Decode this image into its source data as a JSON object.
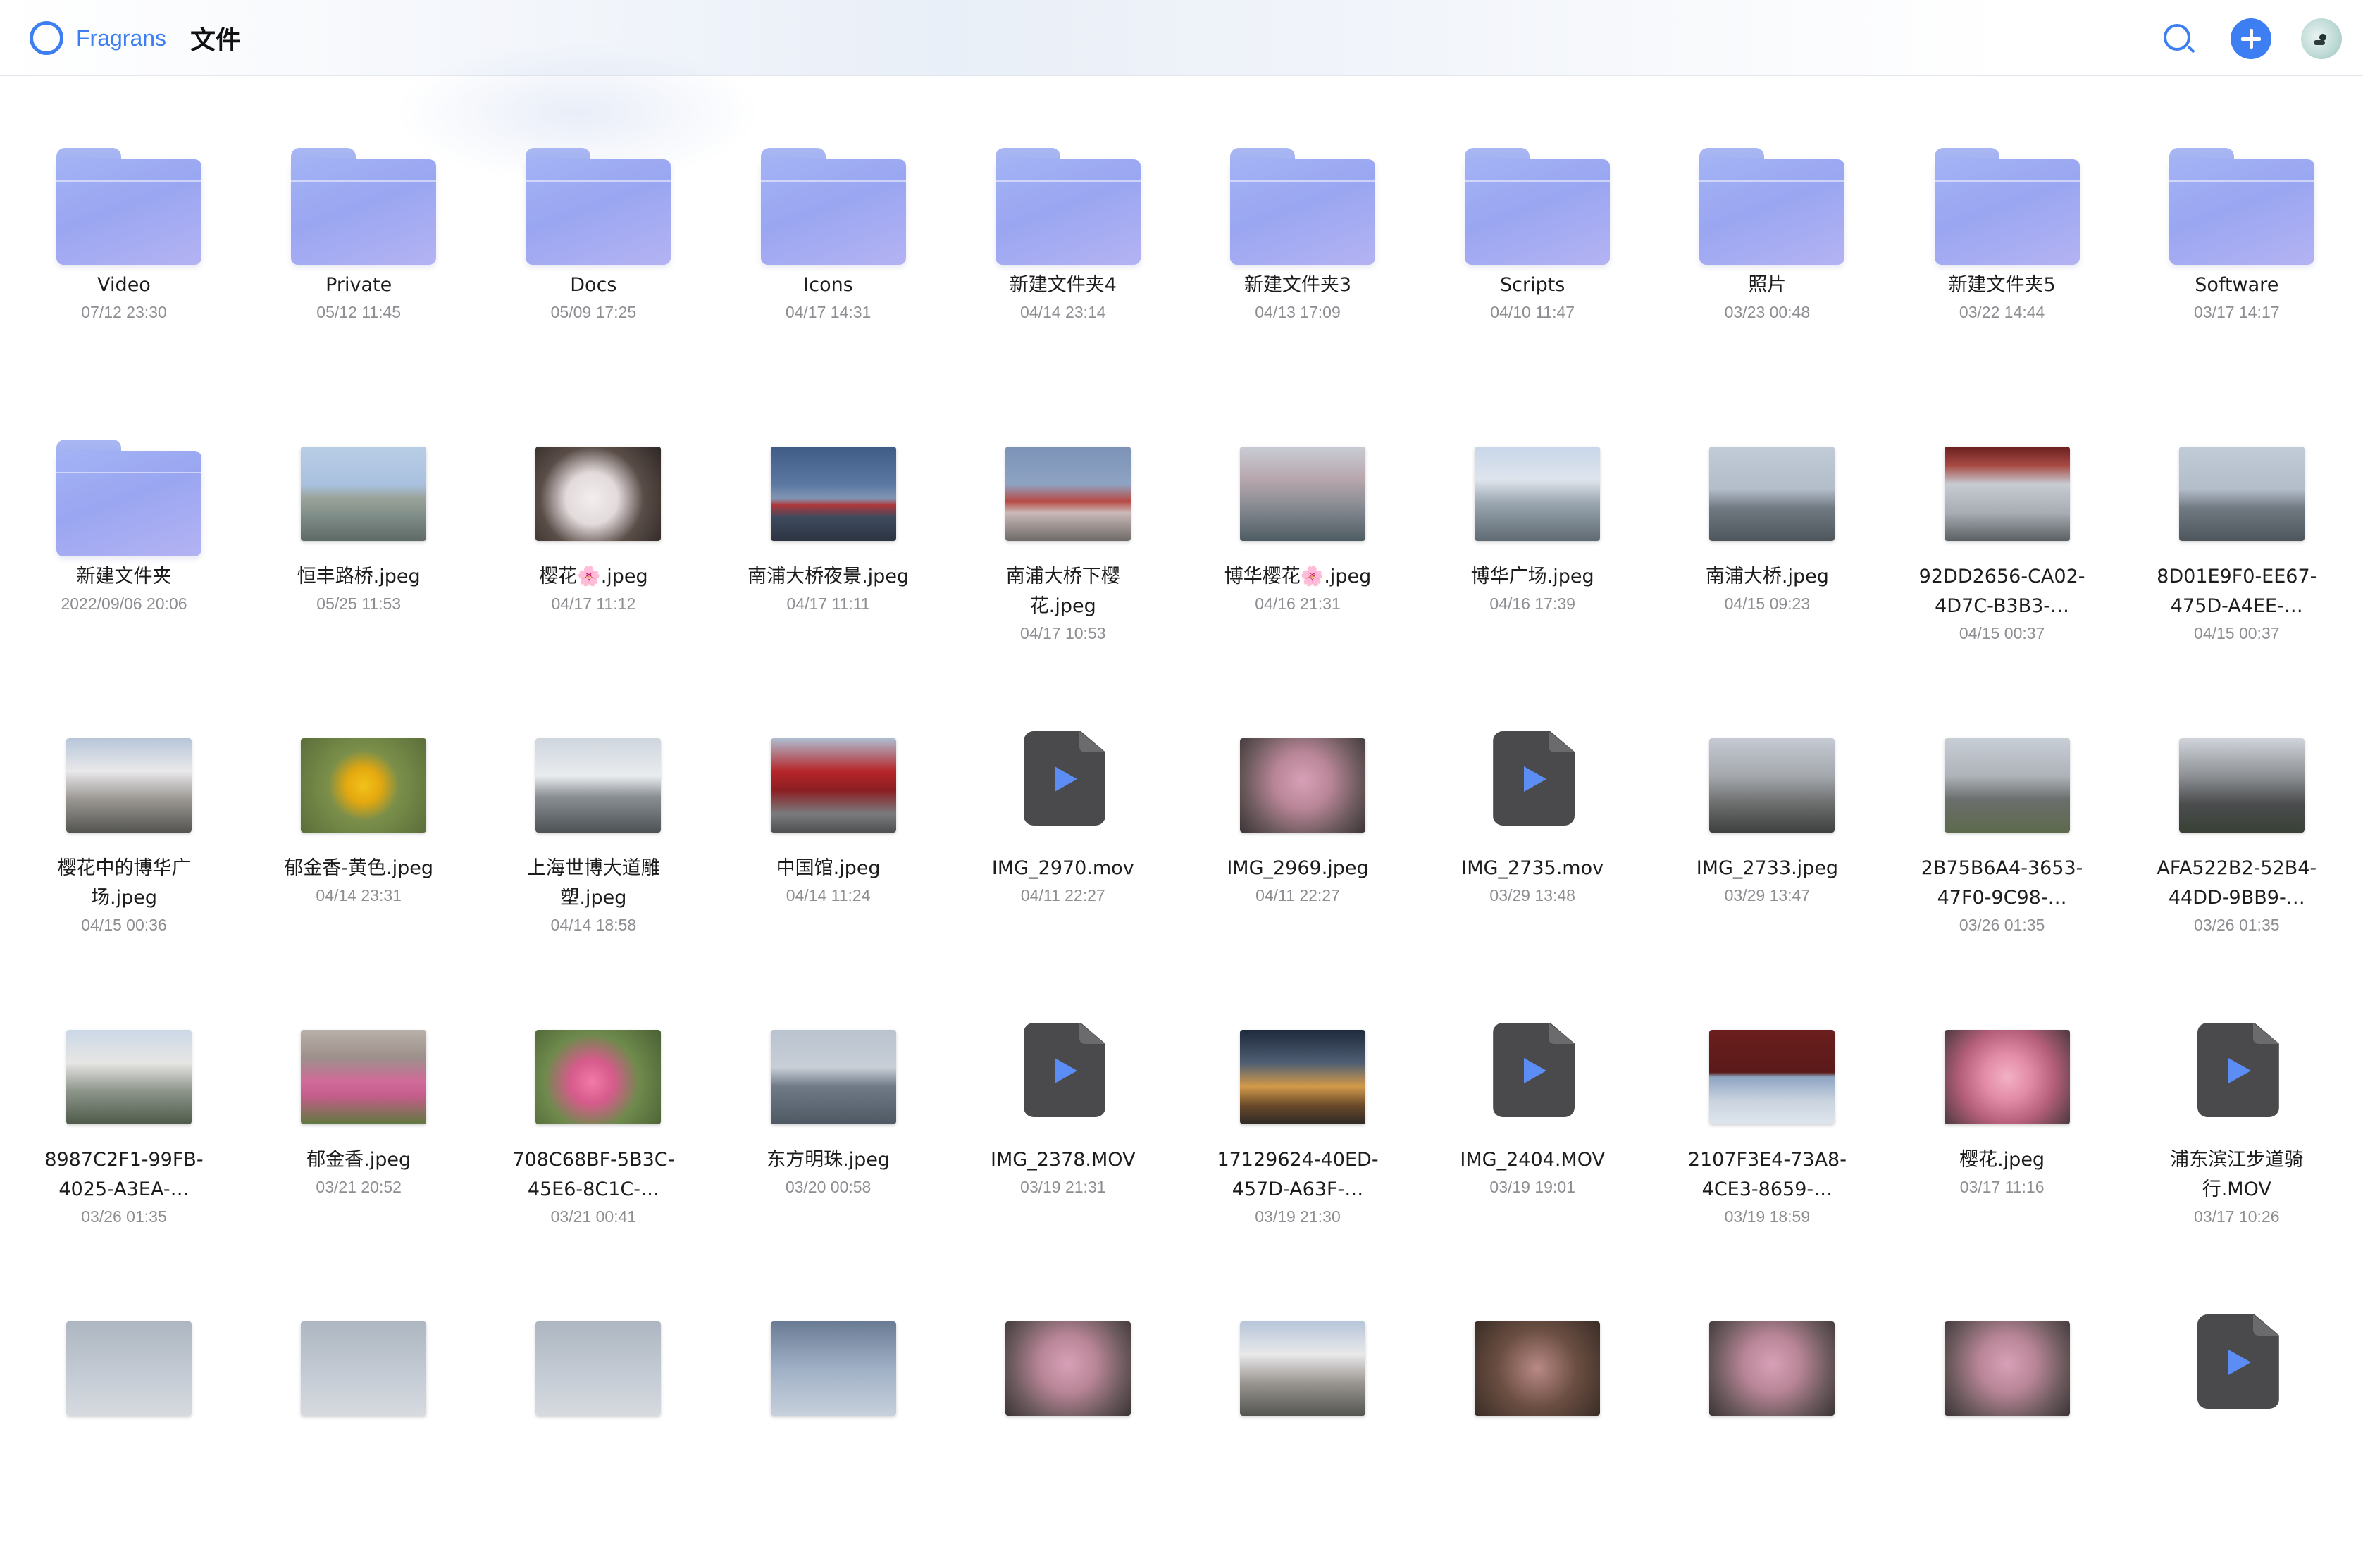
{
  "app": {
    "brand": "Fragrans",
    "title": "文件"
  },
  "colors": {
    "accent": "#3d7ff2",
    "folder": "#a3b3f5",
    "video_icon": "#4a4a4c"
  },
  "toolbar": {
    "search_icon": "search-icon",
    "add_icon": "plus-icon",
    "avatar_icon": "avatar"
  },
  "rows": [
    [
      {
        "kind": "folder",
        "name": "Video",
        "date": "07/12 23:30"
      },
      {
        "kind": "folder",
        "name": "Private",
        "date": "05/12 11:45"
      },
      {
        "kind": "folder",
        "name": "Docs",
        "date": "05/09 17:25"
      },
      {
        "kind": "folder",
        "name": "Icons",
        "date": "04/17 14:31"
      },
      {
        "kind": "folder",
        "name": "新建文件夹4",
        "date": "04/14 23:14"
      },
      {
        "kind": "folder",
        "name": "新建文件夹3",
        "date": "04/13 17:09"
      },
      {
        "kind": "folder",
        "name": "Scripts",
        "date": "04/10 11:47"
      },
      {
        "kind": "folder",
        "name": "照片",
        "date": "03/23 00:48"
      },
      {
        "kind": "folder",
        "name": "新建文件夹5",
        "date": "03/22 14:44"
      },
      {
        "kind": "folder",
        "name": "Software",
        "date": "03/17 14:17"
      }
    ],
    [
      {
        "kind": "folder",
        "name": "新建文件夹",
        "date": "2022/09/06 20:06"
      },
      {
        "kind": "image",
        "name": "恒丰路桥.jpeg",
        "date": "05/25 11:53",
        "thumb": "bridge-river"
      },
      {
        "kind": "image",
        "name": "樱花🌸.jpeg",
        "date": "04/17 11:12",
        "thumb": "blossom-close"
      },
      {
        "kind": "image",
        "name": "南浦大桥夜景.jpeg",
        "date": "04/17 11:11",
        "thumb": "bridge-night"
      },
      {
        "kind": "image",
        "name": "南浦大桥下樱\n花.jpeg",
        "date": "04/17 10:53",
        "thumb": "bridge-blossom"
      },
      {
        "kind": "image",
        "name": "博华樱花🌸.jpeg",
        "date": "04/16 21:31",
        "thumb": "blossom-street"
      },
      {
        "kind": "image",
        "name": "博华广场.jpeg",
        "date": "04/16 17:39",
        "thumb": "plaza"
      },
      {
        "kind": "image",
        "name": "南浦大桥.jpeg",
        "date": "04/15 09:23",
        "thumb": "bridge-tower"
      },
      {
        "kind": "image",
        "name": "92DD2656-CA02-\n4D7C-B3B3-…",
        "date": "04/15 00:37",
        "thumb": "bridge-red"
      },
      {
        "kind": "image",
        "name": "8D01E9F0-EE67-\n475D-A4EE-…",
        "date": "04/15 00:37",
        "thumb": "bridge-tower"
      }
    ],
    [
      {
        "kind": "image",
        "name": "樱花中的博华广\n场.jpeg",
        "date": "04/15 00:36",
        "thumb": "blossom-white"
      },
      {
        "kind": "image",
        "name": "郁金香-黄色.jpeg",
        "date": "04/14 23:31",
        "thumb": "tulip-yellow"
      },
      {
        "kind": "image",
        "name": "上海世博大道雕\n塑.jpeg",
        "date": "04/14 18:58",
        "thumb": "expo"
      },
      {
        "kind": "image",
        "name": "中国馆.jpeg",
        "date": "04/14 11:24",
        "thumb": "pavilion"
      },
      {
        "kind": "video",
        "name": "IMG_2970.mov",
        "date": "04/11 22:27"
      },
      {
        "kind": "image",
        "name": "IMG_2969.jpeg",
        "date": "04/11 22:27",
        "thumb": "blossom-pink"
      },
      {
        "kind": "video",
        "name": "IMG_2735.mov",
        "date": "03/29 13:48"
      },
      {
        "kind": "image",
        "name": "IMG_2733.jpeg",
        "date": "03/29 13:47",
        "thumb": "tree-sky"
      },
      {
        "kind": "image",
        "name": "2B75B6A4-3653-\n47F0-9C98-…",
        "date": "03/26 01:35",
        "thumb": "tree-city"
      },
      {
        "kind": "image",
        "name": "AFA522B2-52B4-\n44DD-9BB9-…",
        "date": "03/26 01:35",
        "thumb": "tree-dark"
      }
    ],
    [
      {
        "kind": "image",
        "name": "8987C2F1-99FB-\n4025-A3EA-…",
        "date": "03/26 01:35",
        "thumb": "tree-white"
      },
      {
        "kind": "image",
        "name": "郁金香.jpeg",
        "date": "03/21 20:52",
        "thumb": "tulip-field"
      },
      {
        "kind": "image",
        "name": "708C68BF-5B3C-\n45E6-8C1C-…",
        "date": "03/21 00:41",
        "thumb": "tulip-pink"
      },
      {
        "kind": "image",
        "name": "东方明珠.jpeg",
        "date": "03/20 00:58",
        "thumb": "skyline"
      },
      {
        "kind": "video",
        "name": "IMG_2378.MOV",
        "date": "03/19 21:31"
      },
      {
        "kind": "image",
        "name": "17129624-40ED-\n457D-A63F-…",
        "date": "03/19 21:30",
        "thumb": "plant-night"
      },
      {
        "kind": "video",
        "name": "IMG_2404.MOV",
        "date": "03/19 19:01"
      },
      {
        "kind": "image",
        "name": "2107F3E4-73A8-\n4CE3-8659-…",
        "date": "03/19 18:59",
        "thumb": "bridge-under"
      },
      {
        "kind": "image",
        "name": "樱花.jpeg",
        "date": "03/17 11:16",
        "thumb": "blossom-pink-close"
      },
      {
        "kind": "video",
        "name": "浦东滨江步道骑\n行.MOV",
        "date": "03/17 10:26"
      }
    ],
    [
      {
        "kind": "image",
        "name": "",
        "date": "",
        "thumb": "sky-grey"
      },
      {
        "kind": "image",
        "name": "",
        "date": "",
        "thumb": "sky-grey"
      },
      {
        "kind": "image",
        "name": "",
        "date": "",
        "thumb": "sky-grey"
      },
      {
        "kind": "image",
        "name": "",
        "date": "",
        "thumb": "tower"
      },
      {
        "kind": "image",
        "name": "",
        "date": "",
        "thumb": "blossom-pink"
      },
      {
        "kind": "image",
        "name": "",
        "date": "",
        "thumb": "blossom-white"
      },
      {
        "kind": "image",
        "name": "",
        "date": "",
        "thumb": "blossom-dark"
      },
      {
        "kind": "image",
        "name": "",
        "date": "",
        "thumb": "blossom-pink"
      },
      {
        "kind": "image",
        "name": "",
        "date": "",
        "thumb": "blossom-pink"
      },
      {
        "kind": "video",
        "name": "",
        "date": ""
      }
    ]
  ]
}
